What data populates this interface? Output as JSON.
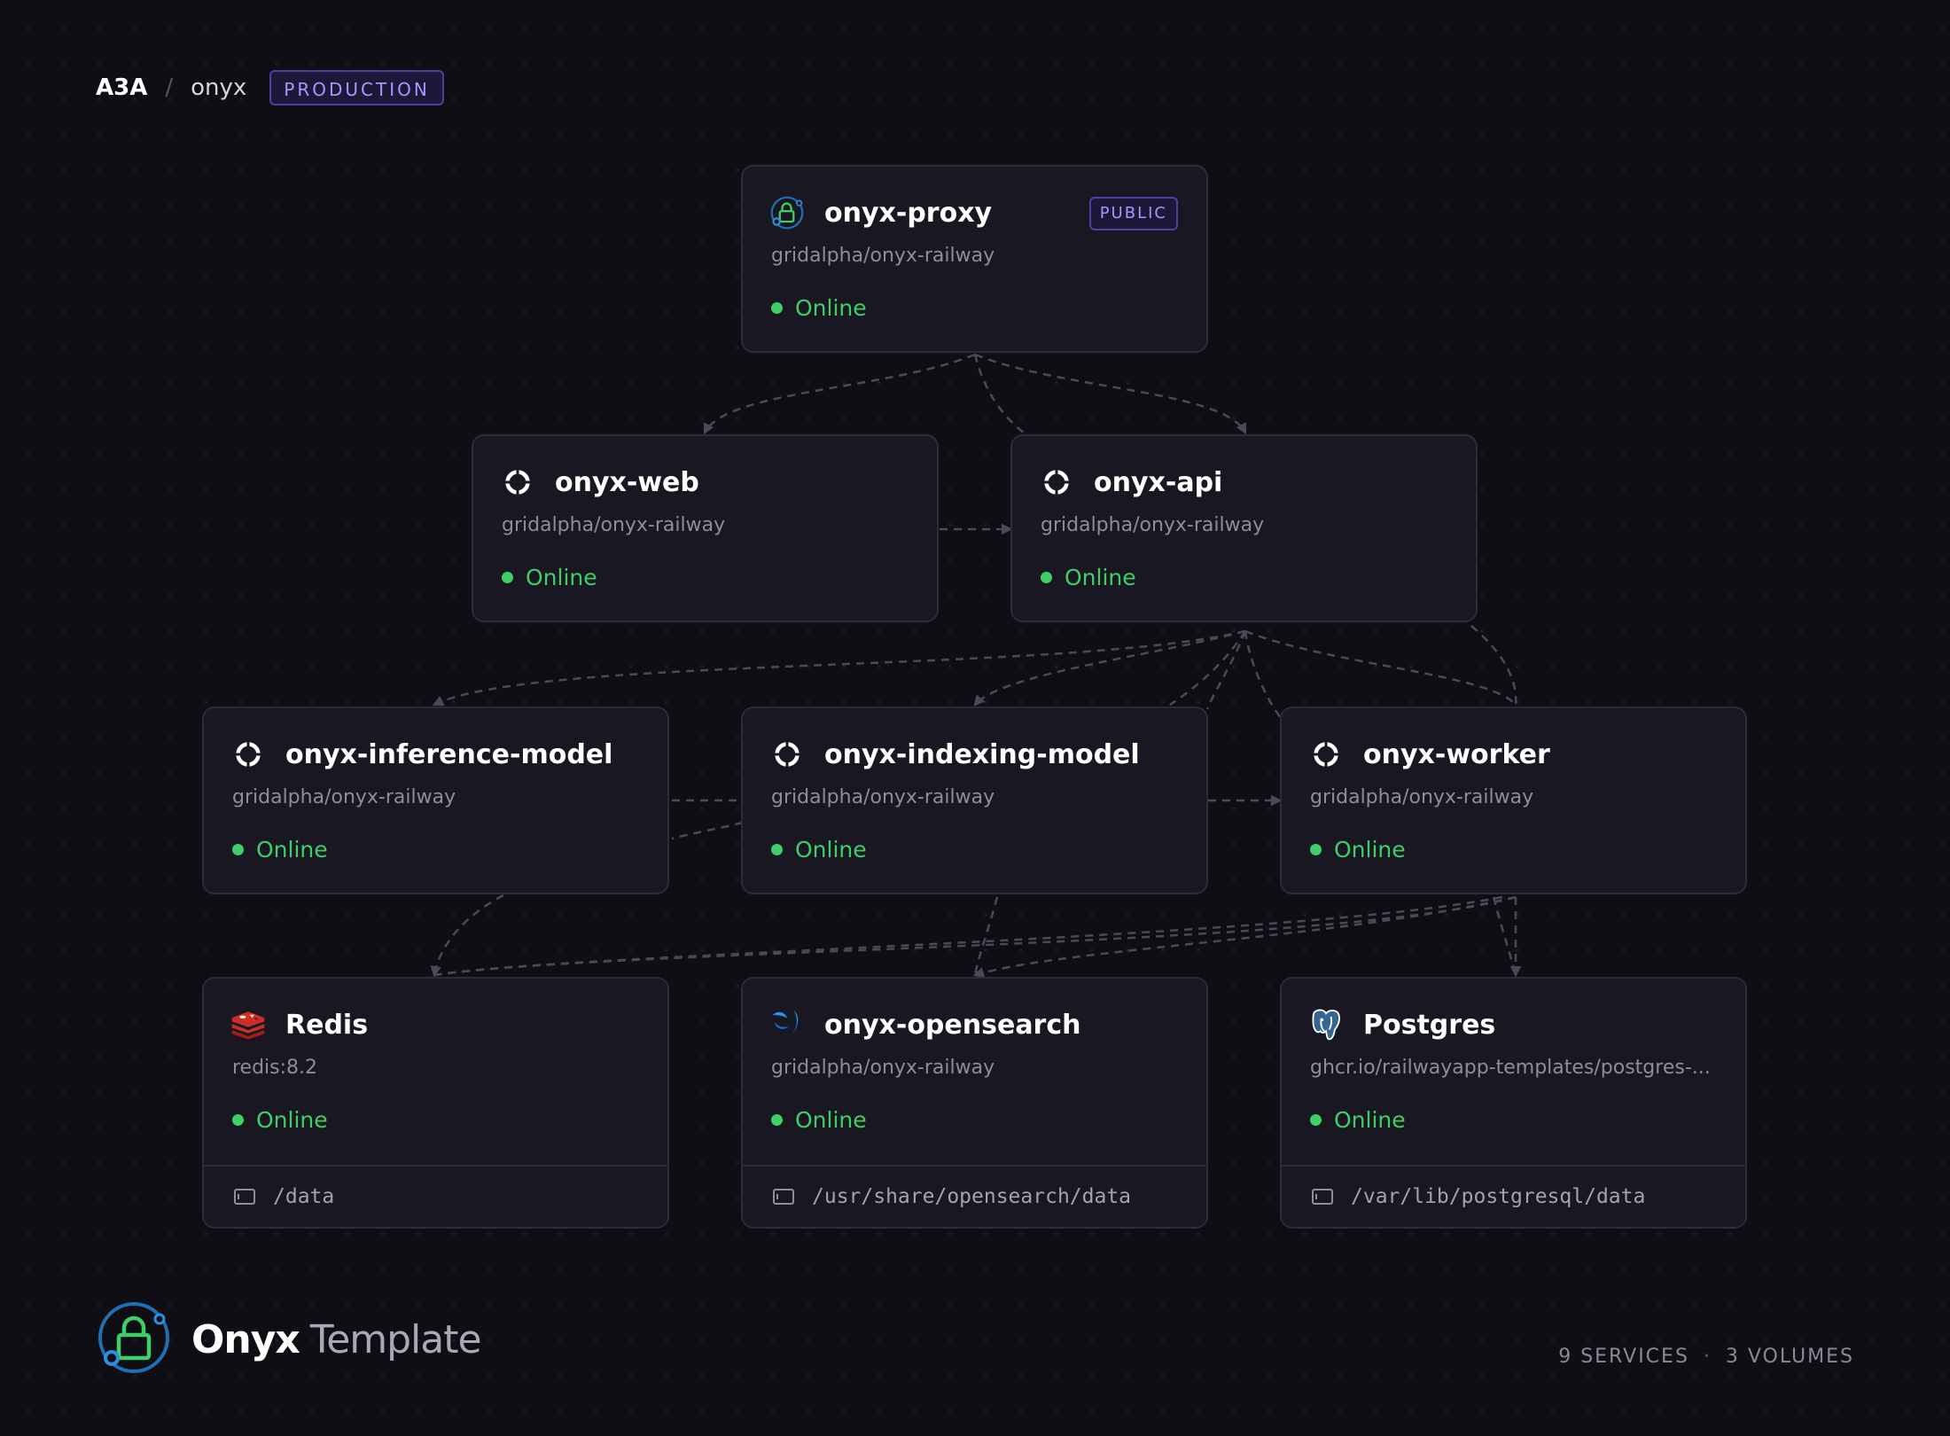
{
  "breadcrumb": {
    "project": "A3A",
    "separator": "/",
    "name": "onyx",
    "environment": "PRODUCTION"
  },
  "services": {
    "proxy": {
      "name": "onyx-proxy",
      "source": "gridalpha/onyx-railway",
      "status": "Online",
      "badge": "PUBLIC",
      "icon": "lock-network-icon"
    },
    "web": {
      "name": "onyx-web",
      "source": "gridalpha/onyx-railway",
      "status": "Online",
      "icon": "onyx-app-icon"
    },
    "api": {
      "name": "onyx-api",
      "source": "gridalpha/onyx-railway",
      "status": "Online",
      "icon": "onyx-app-icon"
    },
    "inference": {
      "name": "onyx-inference-model",
      "source": "gridalpha/onyx-railway",
      "status": "Online",
      "icon": "onyx-app-icon"
    },
    "indexing": {
      "name": "onyx-indexing-model",
      "source": "gridalpha/onyx-railway",
      "status": "Online",
      "icon": "onyx-app-icon"
    },
    "worker": {
      "name": "onyx-worker",
      "source": "gridalpha/onyx-railway",
      "status": "Online",
      "icon": "onyx-app-icon"
    },
    "redis": {
      "name": "Redis",
      "source": "redis:8.2",
      "status": "Online",
      "volume": "/data",
      "icon": "redis-icon"
    },
    "opensearch": {
      "name": "onyx-opensearch",
      "source": "gridalpha/onyx-railway",
      "status": "Online",
      "volume": "/usr/share/opensearch/data",
      "icon": "opensearch-icon"
    },
    "postgres": {
      "name": "Postgres",
      "source": "ghcr.io/railwayapp-templates/postgres-...",
      "status": "Online",
      "volume": "/var/lib/postgresql/data",
      "icon": "postgres-icon"
    }
  },
  "footer": {
    "brand": "Onyx",
    "brand_suffix": "Template",
    "services_count": "9 SERVICES",
    "separator": "·",
    "volumes_count": "3 VOLUMES"
  },
  "colors": {
    "background": "#0f0e14",
    "card": "#181722",
    "status_online": "#3fce67",
    "accent": "#a895ff"
  }
}
